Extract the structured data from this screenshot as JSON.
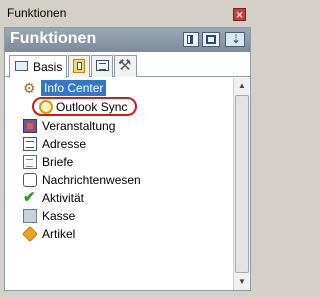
{
  "window": {
    "title": "Funktionen",
    "close_glyph": "✕"
  },
  "panel": {
    "title": "Funktionen"
  },
  "tabs": [
    {
      "label": "Basis",
      "icon": "tab-page-icon",
      "active": true
    },
    {
      "label": "",
      "icon": "clipboard-icon"
    },
    {
      "label": "",
      "icon": "list-icon"
    },
    {
      "label": "",
      "icon": "tools-icon"
    }
  ],
  "items": [
    {
      "label": "Info Center",
      "icon": "gear-icon",
      "selected": true
    },
    {
      "label": "Outlook Sync",
      "icon": "clock-icon",
      "child": true,
      "highlighted": true
    },
    {
      "label": "Veranstaltung",
      "icon": "event-icon"
    },
    {
      "label": "Adresse",
      "icon": "address-card-icon"
    },
    {
      "label": "Briefe",
      "icon": "letter-icon"
    },
    {
      "label": "Nachrichtenwesen",
      "icon": "message-icon"
    },
    {
      "label": "Aktivität",
      "icon": "checkmark-icon"
    },
    {
      "label": "Kasse",
      "icon": "cash-register-icon"
    },
    {
      "label": "Artikel",
      "icon": "tag-icon"
    }
  ],
  "colors": {
    "selection": "#3178c8",
    "highlight_ring": "#d11a1a",
    "header": "#8797a7"
  }
}
